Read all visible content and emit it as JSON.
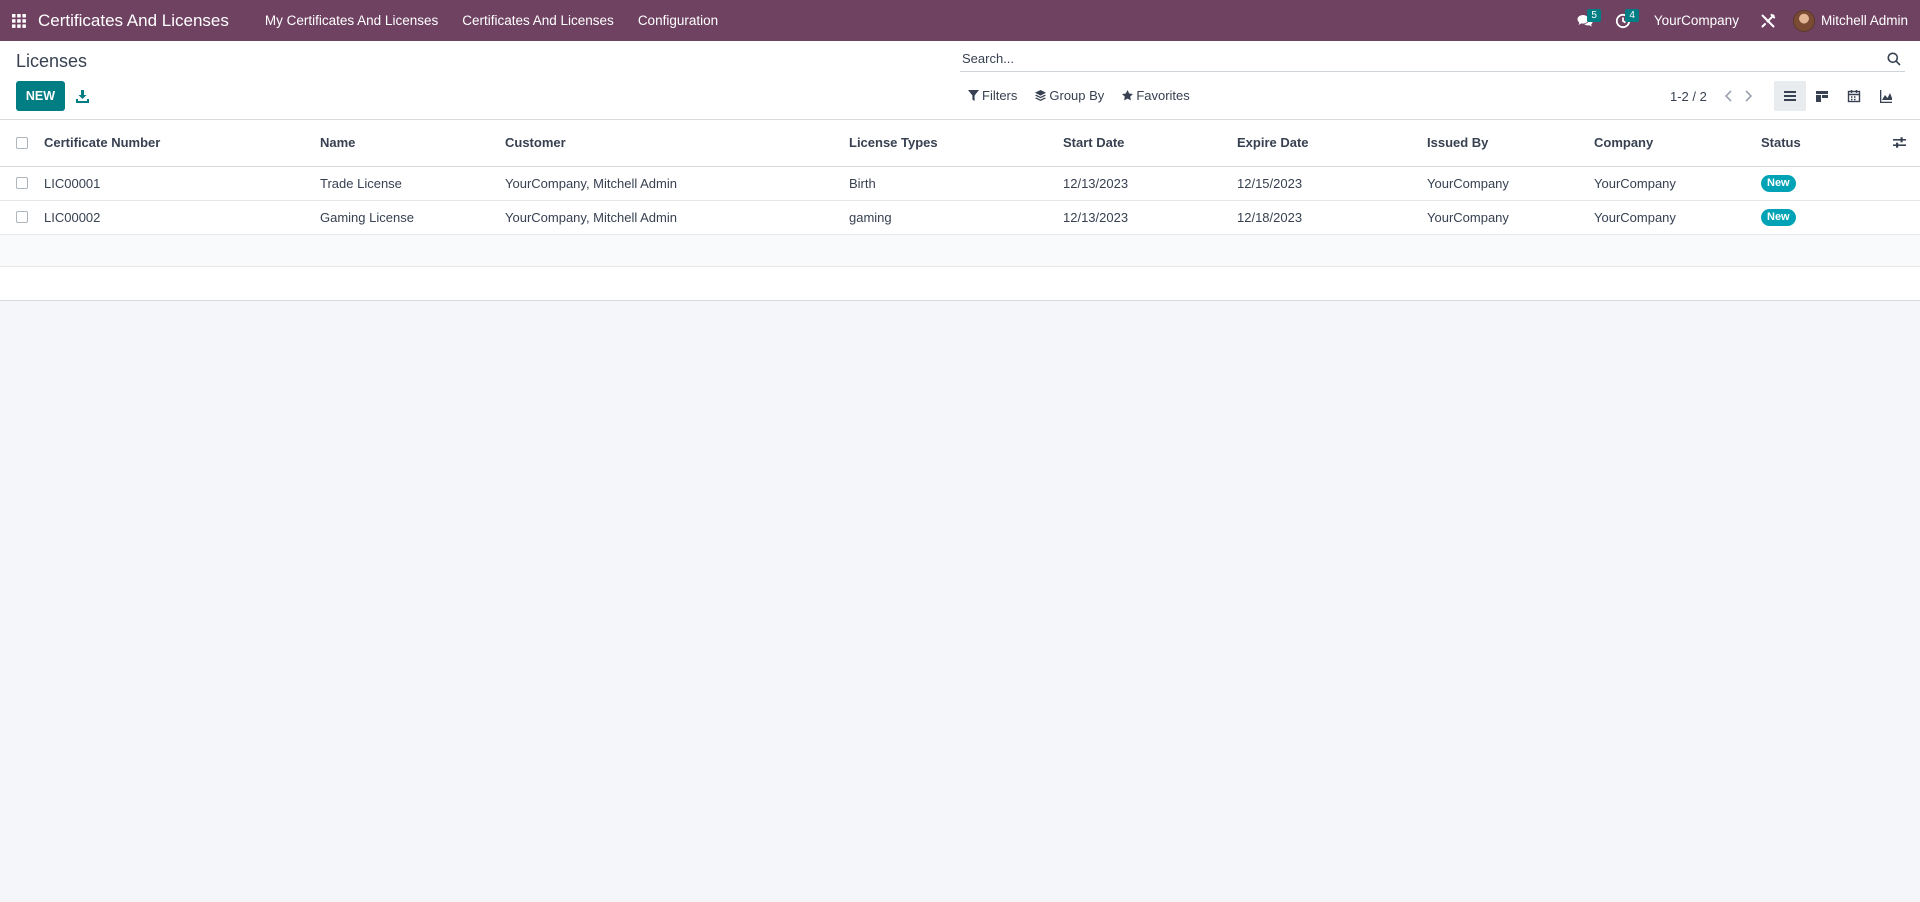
{
  "navbar": {
    "app_title": "Certificates And Licenses",
    "menus": [
      "My Certificates And Licenses",
      "Certificates And Licenses",
      "Configuration"
    ],
    "messages_count": "5",
    "activities_count": "4",
    "company": "YourCompany",
    "user": "Mitchell Admin"
  },
  "control": {
    "title": "Licenses",
    "new_label": "NEW",
    "search_placeholder": "Search...",
    "filters_label": "Filters",
    "groupby_label": "Group By",
    "favorites_label": "Favorites",
    "pager": "1-2 / 2"
  },
  "table": {
    "columns": [
      "Certificate Number",
      "Name",
      "Customer",
      "License Types",
      "Start Date",
      "Expire Date",
      "Issued By",
      "Company",
      "Status"
    ],
    "rows": [
      [
        "LIC00001",
        "Trade License",
        "YourCompany, Mitchell Admin",
        "Birth",
        "12/13/2023",
        "12/15/2023",
        "YourCompany",
        "YourCompany",
        "New"
      ],
      [
        "LIC00002",
        "Gaming License",
        "YourCompany, Mitchell Admin",
        "gaming",
        "12/13/2023",
        "12/18/2023",
        "YourCompany",
        "YourCompany",
        "New"
      ]
    ]
  },
  "colors": {
    "navbar": "#6f4262",
    "primary": "#017e84",
    "status_new": "#00a3b5"
  },
  "icons": [
    "apps-grid-icon",
    "chat-icon",
    "clock-icon",
    "tools-icon",
    "download-icon",
    "search-icon",
    "filter-icon",
    "layers-icon",
    "star-icon",
    "chevron-left-icon",
    "chevron-right-icon",
    "list-view-icon",
    "kanban-view-icon",
    "calendar-view-icon",
    "graph-view-icon",
    "optional-columns-icon"
  ]
}
